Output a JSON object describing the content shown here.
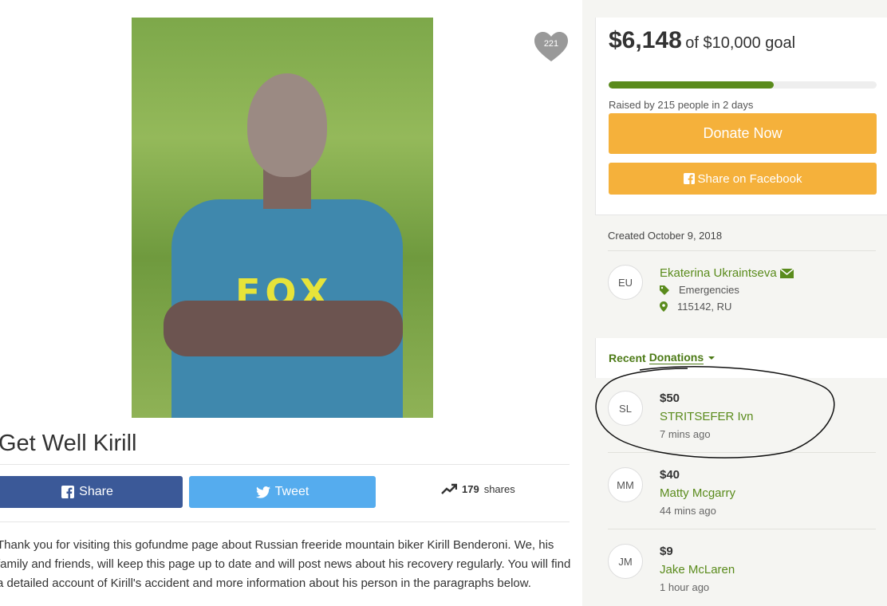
{
  "campaign": {
    "like_count": "221",
    "title": "Get Well Kirill",
    "photo_logo_text": "FOX",
    "share_button_label": "Share",
    "tweet_button_label": "Tweet",
    "share_count": "179",
    "share_count_label": "shares",
    "story": "Thank you for visiting this gofundme page about Russian freeride mountain biker Kirill Benderoni. We, his family and friends, will keep this page up to date and will post news about his recovery regularly. You will find a detailed account of Kirill's accident and more information about his person in the paragraphs below."
  },
  "fundraising": {
    "raised": "$6,148",
    "goal_text": "of $10,000 goal",
    "progress_fraction": 0.6148,
    "raised_by": "Raised by 215 people in 2 days",
    "donate_label": "Donate Now",
    "facebook_label": "Share on Facebook"
  },
  "organizer": {
    "created": "Created October 9, 2018",
    "initials": "EU",
    "name": "Ekaterina Ukraintseva",
    "category": "Emergencies",
    "location": "115142, RU"
  },
  "donations": {
    "heading_prefix": "Recent",
    "heading_dropdown": "Donations",
    "items": [
      {
        "initials": "SL",
        "amount": "$50",
        "name": "STRITSEFER Ivn",
        "time": "7 mins ago"
      },
      {
        "initials": "MM",
        "amount": "$40",
        "name": "Matty Mcgarry",
        "time": "44 mins ago"
      },
      {
        "initials": "JM",
        "amount": "$9",
        "name": "Jake McLaren",
        "time": "1 hour ago"
      }
    ]
  },
  "colors": {
    "accent_green": "#5a8b1c",
    "donate_orange": "#f5b13b",
    "facebook_blue": "#3b5998",
    "twitter_blue": "#55acee"
  },
  "icons": [
    "heart-icon",
    "facebook-icon",
    "twitter-icon",
    "trending-icon",
    "envelope-icon",
    "tag-icon",
    "location-pin-icon",
    "caret-down-icon"
  ]
}
